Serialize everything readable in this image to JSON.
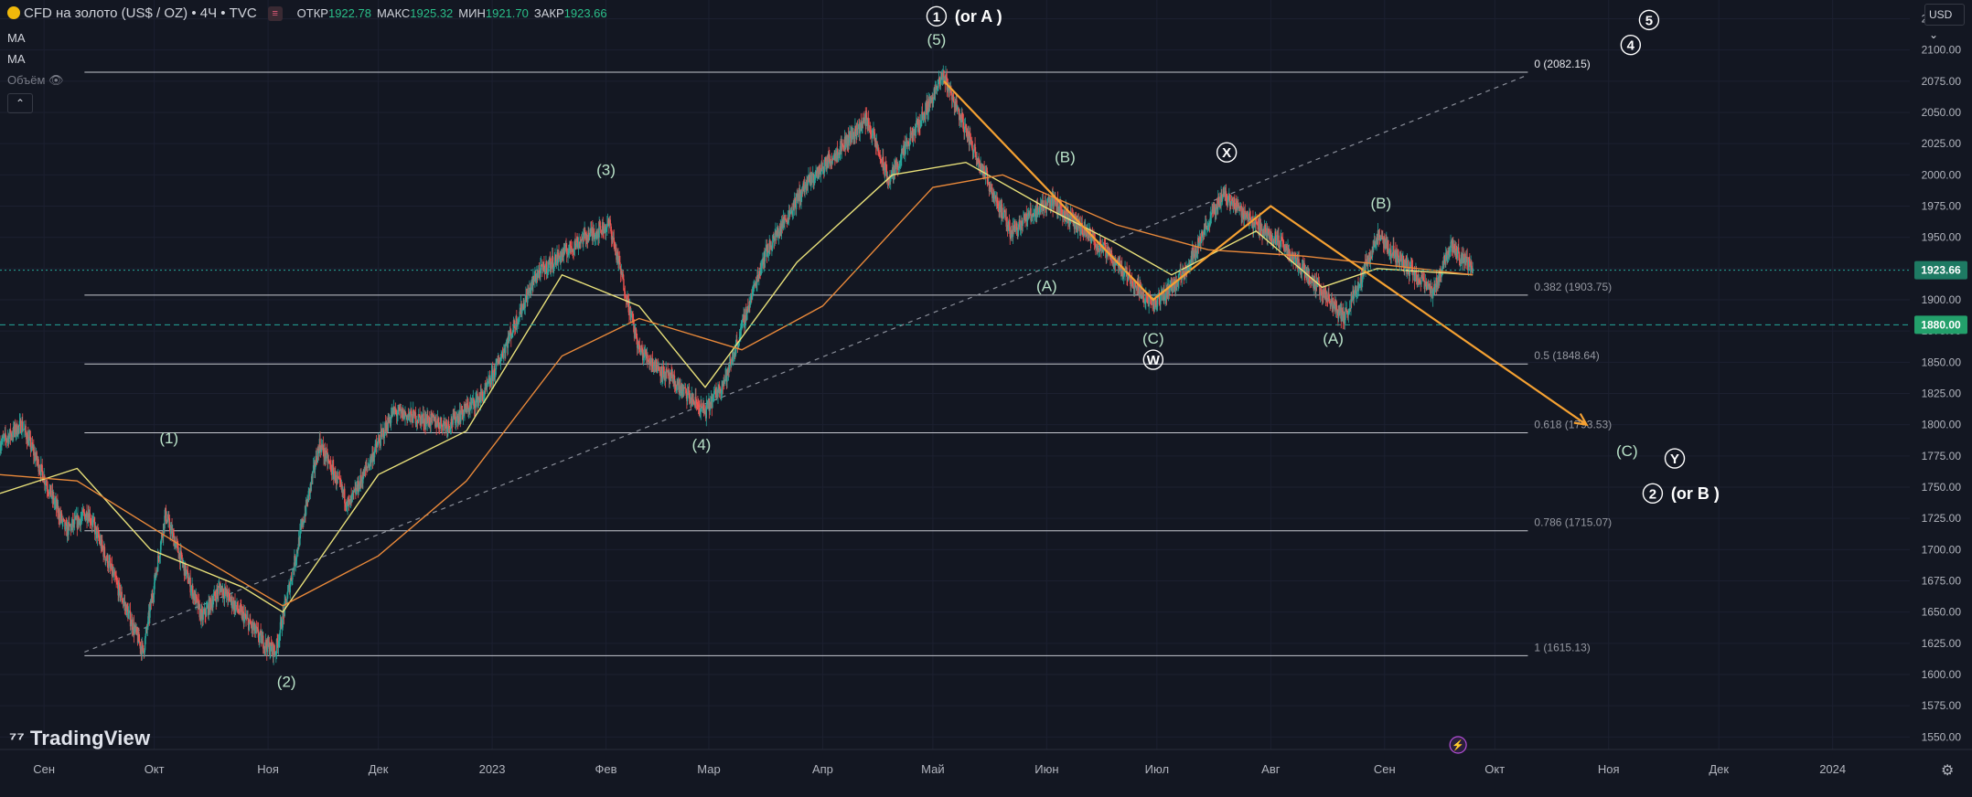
{
  "header": {
    "title": "CFD на золото (US$ / OZ) • 4Ч • TVC",
    "ohlc": [
      {
        "key": "ОТКР",
        "value": "1922.78"
      },
      {
        "key": "МАКС",
        "value": "1925.32"
      },
      {
        "key": "МИН",
        "value": "1921.70"
      },
      {
        "key": "ЗАКР",
        "value": "1923.66"
      }
    ],
    "indicators": [
      "MA",
      "MA"
    ],
    "volume_label": "Объём",
    "currency": "USD"
  },
  "brand": "TradingView",
  "chart_data": {
    "type": "candlestick",
    "symbol": "CFD на золото (US$ / OZ)",
    "timeframe": "4Ч",
    "source": "TVC",
    "ylim": [
      1540,
      2140
    ],
    "y_ticks": [
      1550,
      1575,
      1600,
      1625,
      1650,
      1675,
      1700,
      1725,
      1750,
      1775,
      1800,
      1825,
      1850,
      1875,
      1900,
      1925,
      1950,
      1975,
      2000,
      2025,
      2050,
      2075,
      2100,
      2125
    ],
    "x_range": [
      "2022-08-20",
      "2024-01-22"
    ],
    "x_ticks": [
      {
        "date": "2022-09-01",
        "label": "Сен"
      },
      {
        "date": "2022-10-01",
        "label": "Окт"
      },
      {
        "date": "2022-11-01",
        "label": "Ноя"
      },
      {
        "date": "2022-12-01",
        "label": "Дек"
      },
      {
        "date": "2023-01-01",
        "label": "2023"
      },
      {
        "date": "2023-02-01",
        "label": "Фев"
      },
      {
        "date": "2023-03-01",
        "label": "Мар"
      },
      {
        "date": "2023-04-01",
        "label": "Апр"
      },
      {
        "date": "2023-05-01",
        "label": "Май"
      },
      {
        "date": "2023-06-01",
        "label": "Июн"
      },
      {
        "date": "2023-07-01",
        "label": "Июл"
      },
      {
        "date": "2023-08-01",
        "label": "Авг"
      },
      {
        "date": "2023-09-01",
        "label": "Сен"
      },
      {
        "date": "2023-10-01",
        "label": "Окт"
      },
      {
        "date": "2023-11-01",
        "label": "Ноя"
      },
      {
        "date": "2023-12-01",
        "label": "Дек"
      },
      {
        "date": "2024-01-01",
        "label": "2024"
      }
    ],
    "price_path": [
      [
        "2022-08-20",
        1785
      ],
      [
        "2022-08-26",
        1800
      ],
      [
        "2022-09-07",
        1715
      ],
      [
        "2022-09-13",
        1730
      ],
      [
        "2022-09-28",
        1618
      ],
      [
        "2022-10-04",
        1728
      ],
      [
        "2022-10-14",
        1645
      ],
      [
        "2022-10-19",
        1670
      ],
      [
        "2022-10-31",
        1625
      ],
      [
        "2022-11-03",
        1618
      ],
      [
        "2022-11-15",
        1785
      ],
      [
        "2022-11-23",
        1735
      ],
      [
        "2022-12-05",
        1810
      ],
      [
        "2022-12-20",
        1800
      ],
      [
        "2022-12-30",
        1825
      ],
      [
        "2023-01-13",
        1920
      ],
      [
        "2023-01-26",
        1950
      ],
      [
        "2023-02-02",
        1960
      ],
      [
        "2023-02-10",
        1860
      ],
      [
        "2023-02-28",
        1810
      ],
      [
        "2023-03-01",
        1815
      ],
      [
        "2023-03-06",
        1840
      ],
      [
        "2023-03-16",
        1935
      ],
      [
        "2023-03-27",
        1990
      ],
      [
        "2023-04-13",
        2045
      ],
      [
        "2023-04-19",
        1995
      ],
      [
        "2023-05-04",
        2080
      ],
      [
        "2023-05-10",
        2035
      ],
      [
        "2023-05-22",
        1955
      ],
      [
        "2023-06-02",
        1980
      ],
      [
        "2023-06-20",
        1930
      ],
      [
        "2023-06-30",
        1895
      ],
      [
        "2023-07-08",
        1920
      ],
      [
        "2023-07-19",
        1985
      ],
      [
        "2023-07-28",
        1960
      ],
      [
        "2023-08-04",
        1945
      ],
      [
        "2023-08-21",
        1885
      ],
      [
        "2023-08-30",
        1950
      ],
      [
        "2023-09-11",
        1915
      ],
      [
        "2023-09-14",
        1905
      ],
      [
        "2023-09-19",
        1945
      ],
      [
        "2023-09-25",
        1923.66
      ]
    ],
    "ma_fast_path": [
      [
        "2022-08-20",
        1745
      ],
      [
        "2022-09-10",
        1765
      ],
      [
        "2022-09-30",
        1700
      ],
      [
        "2022-10-25",
        1670
      ],
      [
        "2022-11-05",
        1650
      ],
      [
        "2022-12-01",
        1760
      ],
      [
        "2022-12-25",
        1795
      ],
      [
        "2023-01-20",
        1920
      ],
      [
        "2023-02-10",
        1895
      ],
      [
        "2023-02-28",
        1830
      ],
      [
        "2023-03-25",
        1930
      ],
      [
        "2023-04-20",
        2000
      ],
      [
        "2023-05-10",
        2010
      ],
      [
        "2023-05-31",
        1975
      ],
      [
        "2023-06-20",
        1945
      ],
      [
        "2023-07-05",
        1920
      ],
      [
        "2023-07-28",
        1955
      ],
      [
        "2023-08-15",
        1910
      ],
      [
        "2023-08-30",
        1925
      ],
      [
        "2023-09-25",
        1920
      ]
    ],
    "ma_slow_path": [
      [
        "2022-08-20",
        1760
      ],
      [
        "2022-09-10",
        1755
      ],
      [
        "2022-10-10",
        1700
      ],
      [
        "2022-11-05",
        1655
      ],
      [
        "2022-12-01",
        1695
      ],
      [
        "2022-12-25",
        1755
      ],
      [
        "2023-01-20",
        1855
      ],
      [
        "2023-02-10",
        1885
      ],
      [
        "2023-03-10",
        1860
      ],
      [
        "2023-04-01",
        1895
      ],
      [
        "2023-05-01",
        1990
      ],
      [
        "2023-05-20",
        2000
      ],
      [
        "2023-06-20",
        1960
      ],
      [
        "2023-07-15",
        1940
      ],
      [
        "2023-08-10",
        1935
      ],
      [
        "2023-09-10",
        1925
      ],
      [
        "2023-09-25",
        1920
      ]
    ],
    "last_price": {
      "value": 1923.66,
      "label": "1923.66"
    },
    "horizontal_level": {
      "value": 1880,
      "label": "1880.00"
    },
    "fibonacci": {
      "from_date": "2022-09-12",
      "to_date": "2023-10-10",
      "levels": [
        {
          "ratio": "0",
          "price": 2082.15,
          "label": "0 (2082.15)"
        },
        {
          "ratio": "0.382",
          "price": 1903.75,
          "label": "0.382 (1903.75)"
        },
        {
          "ratio": "0.5",
          "price": 1848.64,
          "label": "0.5 (1848.64)"
        },
        {
          "ratio": "0.618",
          "price": 1793.53,
          "label": "0.618 (1793.53)"
        },
        {
          "ratio": "0.786",
          "price": 1715.07,
          "label": "0.786 (1715.07)"
        },
        {
          "ratio": "1",
          "price": 1615.13,
          "label": "1 (1615.13)"
        }
      ]
    },
    "trendline": {
      "from": [
        "2022-09-12",
        1618
      ],
      "to": [
        "2023-10-10",
        2080
      ],
      "style": "dashed"
    },
    "orange_path": [
      [
        "2023-05-04",
        2075
      ],
      [
        "2023-06-30",
        1900
      ],
      [
        "2023-08-01",
        1975
      ],
      [
        "2023-10-26",
        1800
      ]
    ],
    "wave_labels": [
      {
        "text": "(1)",
        "date": "2022-10-05",
        "price": 1785
      },
      {
        "text": "(2)",
        "date": "2022-11-06",
        "price": 1590
      },
      {
        "text": "(3)",
        "date": "2023-02-01",
        "price": 2000
      },
      {
        "text": "(4)",
        "date": "2023-02-27",
        "price": 1780
      },
      {
        "text": "(5)",
        "date": "2023-05-02",
        "price": 2104
      },
      {
        "text": "(A)",
        "date": "2023-06-01",
        "price": 1907
      },
      {
        "text": "(B)",
        "date": "2023-06-06",
        "price": 2010
      },
      {
        "text": "(C)",
        "date": "2023-06-30",
        "price": 1865
      },
      {
        "text": "(A)",
        "date": "2023-08-18",
        "price": 1865
      },
      {
        "text": "(B)",
        "date": "2023-08-31",
        "price": 1973
      },
      {
        "text": "(C)",
        "date": "2023-11-06",
        "price": 1775
      }
    ],
    "circle_labels": [
      {
        "text": "1",
        "date": "2023-05-02",
        "price": 2127,
        "suffix": "(or A )"
      },
      {
        "text": "W",
        "date": "2023-06-30",
        "price": 1852
      },
      {
        "text": "X",
        "date": "2023-07-20",
        "price": 2018
      },
      {
        "text": "4",
        "date": "2023-11-07",
        "price": 2104
      },
      {
        "text": "5",
        "date": "2023-11-12",
        "price": 2124
      },
      {
        "text": "Y",
        "date": "2023-11-19",
        "price": 1773
      },
      {
        "text": "2",
        "date": "2023-11-13",
        "price": 1745,
        "suffix": "(or B )"
      }
    ]
  }
}
